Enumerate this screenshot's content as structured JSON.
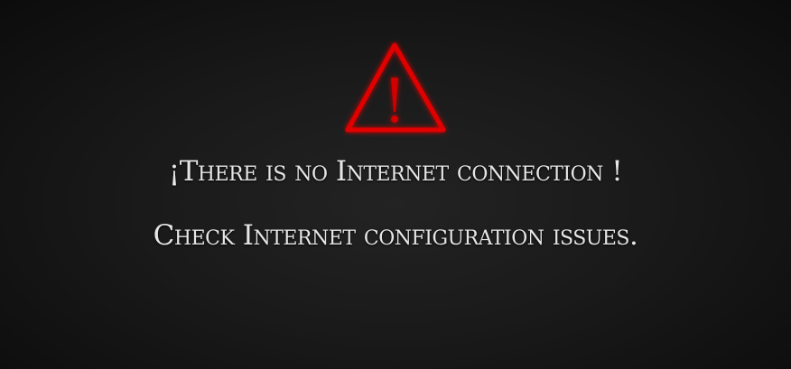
{
  "error": {
    "icon": "warning-triangle-icon",
    "accent": "#e00000",
    "title": "¡There is no Internet connection !",
    "detail": "Check Internet configuration issues."
  }
}
